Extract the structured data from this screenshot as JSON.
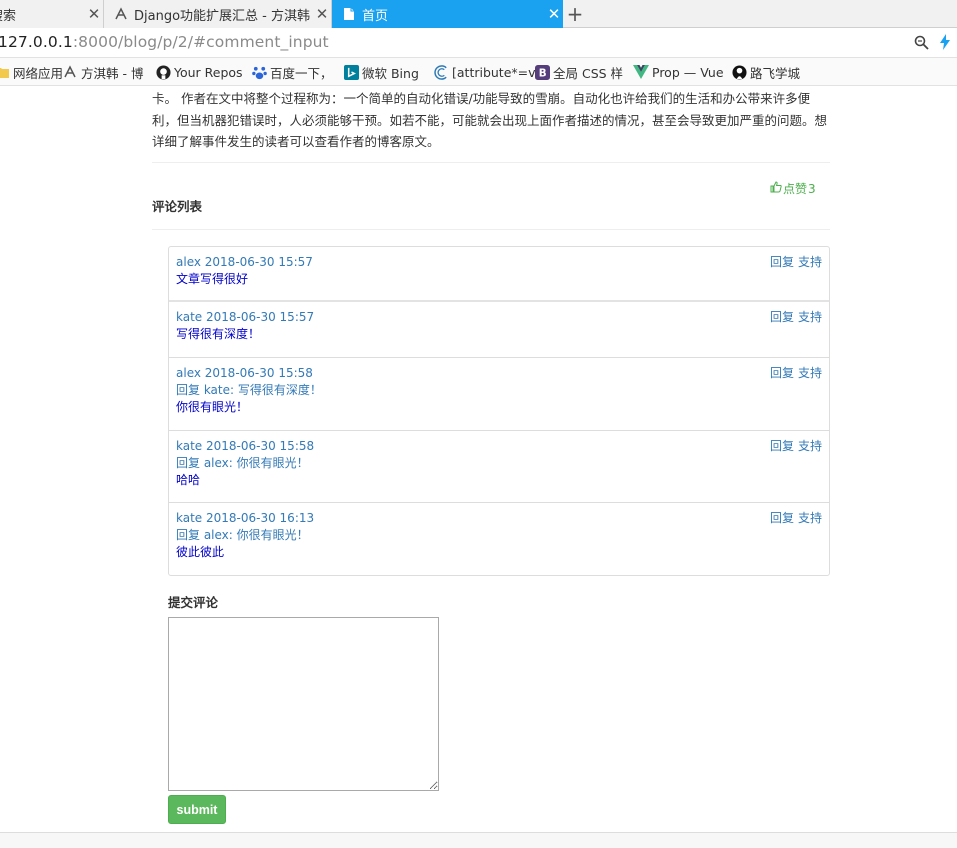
{
  "browser": {
    "tabs": [
      {
        "title": "搜索",
        "icon": "search-page-icon"
      },
      {
        "title": "Django功能扩展汇总 - 方淇韩 -",
        "icon": "blog-icon"
      },
      {
        "title": "首页",
        "icon": "page-icon",
        "active": true
      }
    ],
    "new_tab": "+",
    "url_host": "127.0.0.1",
    "url_rest": ":8000/blog/p/2/#comment_input",
    "bookmarks": [
      {
        "label": "网络应用",
        "icon": "folder-icon"
      },
      {
        "label": "方淇韩 - 博",
        "icon": "blog-icon"
      },
      {
        "label": "Your Repos",
        "icon": "github-icon"
      },
      {
        "label": "百度一下，",
        "icon": "baidu-icon"
      },
      {
        "label": "微软 Bing",
        "icon": "bing-icon"
      },
      {
        "label": "[attribute*=v",
        "icon": "w3-icon"
      },
      {
        "label": "全局 CSS 样",
        "icon": "bootstrap-icon"
      },
      {
        "label": "Prop — Vue",
        "icon": "vue-icon"
      },
      {
        "label": "路飞学城",
        "icon": "luffy-icon"
      }
    ]
  },
  "article": {
    "text": "卡。 作者在文中将整个过程称为：一个简单的自动化错误/功能导致的雪崩。自动化也许给我们的生活和办公带来许多便利，但当机器犯错误时，人必须能够干预。如若不能，可能就会出现上面作者描述的情况，甚至会导致更加严重的问题。想详细了解事件发生的读者可以查看作者的博客原文。",
    "like_label": "点赞",
    "like_count": "3"
  },
  "comments_section": {
    "title": "评论列表",
    "reply_label": "回复",
    "support_label": "支持",
    "items": [
      {
        "meta": "alex 2018-06-30 15:57",
        "reply_to": "",
        "body": "文章写得很好"
      },
      {
        "meta": "kate 2018-06-30 15:57",
        "reply_to": "",
        "body": "写得很有深度！"
      },
      {
        "meta": "alex 2018-06-30 15:58",
        "reply_to": "回复 kate: 写得很有深度！",
        "body": "你很有眼光！"
      },
      {
        "meta": "kate 2018-06-30 15:58",
        "reply_to": "回复 alex: 你很有眼光！",
        "body": "哈哈"
      },
      {
        "meta": "kate 2018-06-30 16:13",
        "reply_to": "回复 alex: 你很有眼光！",
        "body": "彼此彼此"
      }
    ]
  },
  "comment_form": {
    "title": "提交评论",
    "textarea_value": "",
    "submit_label": "submit"
  },
  "colors": {
    "active_tab": "#1aa1f0",
    "link": "#337ab7",
    "comment_body": "#0000cc",
    "like": "#4cae4c",
    "submit": "#5cb85c"
  }
}
